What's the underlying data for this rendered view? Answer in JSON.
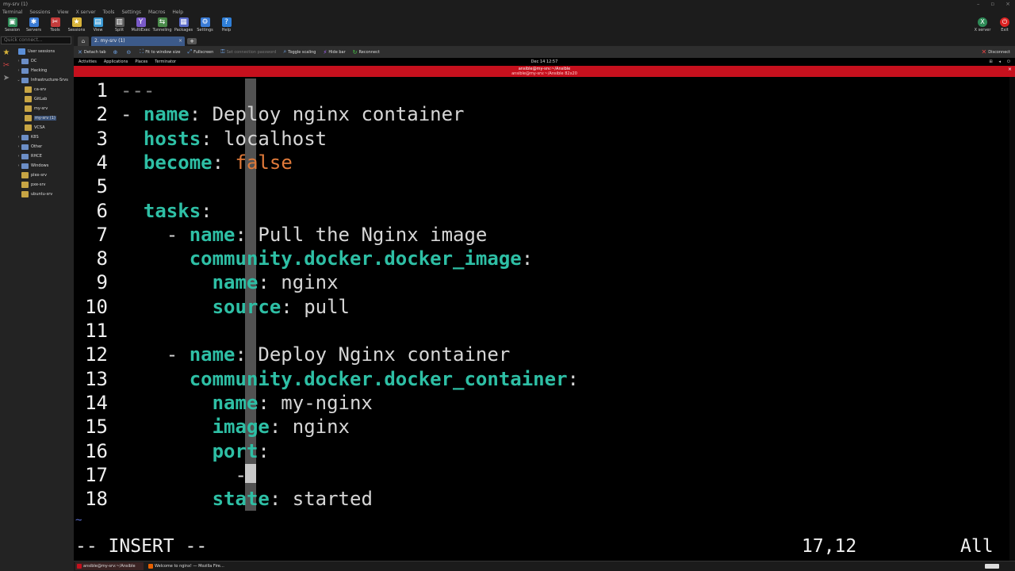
{
  "window": {
    "title": "my-srv (1)"
  },
  "menu": [
    "Terminal",
    "Sessions",
    "View",
    "X server",
    "Tools",
    "Settings",
    "Macros",
    "Help"
  ],
  "toolbar": [
    {
      "label": "Session",
      "icon": "session-icon",
      "color": "#2e8b57"
    },
    {
      "label": "Servers",
      "icon": "servers-icon",
      "color": "#3a7bd5"
    },
    {
      "label": "Tools",
      "icon": "tools-icon",
      "color": "#c43c3c"
    },
    {
      "label": "Sessions",
      "icon": "star-icon",
      "color": "#d9b43a"
    },
    {
      "label": "View",
      "icon": "view-icon",
      "color": "#3a9ad5"
    },
    {
      "label": "Split",
      "icon": "split-icon",
      "color": "#5a5a5a"
    },
    {
      "label": "MultiExec",
      "icon": "multiexec-icon",
      "color": "#7a5ac8"
    },
    {
      "label": "Tunneling",
      "icon": "tunneling-icon",
      "color": "#4a8a4a"
    },
    {
      "label": "Packages",
      "icon": "packages-icon",
      "color": "#5a6ac8"
    },
    {
      "label": "Settings",
      "icon": "settings-icon",
      "color": "#3a7bd5"
    },
    {
      "label": "Help",
      "icon": "help-icon",
      "color": "#2f7fd8"
    }
  ],
  "toolbar_right": [
    {
      "label": "X server",
      "icon": "x-server-icon",
      "color": "#2e8b57"
    },
    {
      "label": "Exit",
      "icon": "power-icon",
      "color": "#d22"
    }
  ],
  "quick_connect": {
    "placeholder": "Quick connect..."
  },
  "tree": [
    {
      "label": "User sessions",
      "type": "user",
      "level": 0,
      "arrow": ""
    },
    {
      "label": "DC",
      "type": "folder",
      "level": 1,
      "arrow": "›"
    },
    {
      "label": "Hacking",
      "type": "folder",
      "level": 1,
      "arrow": "›"
    },
    {
      "label": "Infrastructure-Srvs",
      "type": "folder",
      "level": 1,
      "arrow": "⌄"
    },
    {
      "label": "ca-srv",
      "type": "session",
      "level": 2,
      "arrow": ""
    },
    {
      "label": "GitLab",
      "type": "session",
      "level": 2,
      "arrow": ""
    },
    {
      "label": "my-srv",
      "type": "session",
      "level": 2,
      "arrow": ""
    },
    {
      "label": "my-srv (1)",
      "type": "session",
      "level": 2,
      "arrow": "",
      "selected": true
    },
    {
      "label": "VCSA",
      "type": "session",
      "level": 2,
      "arrow": ""
    },
    {
      "label": "K8S",
      "type": "folder",
      "level": 1,
      "arrow": "›"
    },
    {
      "label": "Other",
      "type": "folder",
      "level": 1,
      "arrow": "›"
    },
    {
      "label": "RHCE",
      "type": "folder",
      "level": 1,
      "arrow": "›"
    },
    {
      "label": "Windows",
      "type": "folder",
      "level": 1,
      "arrow": "›"
    },
    {
      "label": "plex-srv",
      "type": "session",
      "level": 1,
      "arrow": ""
    },
    {
      "label": "pxe-srv",
      "type": "session",
      "level": 1,
      "arrow": ""
    },
    {
      "label": "ubuntu-srv",
      "type": "session",
      "level": 1,
      "arrow": ""
    }
  ],
  "tabs": {
    "active_label": "2. my-srv (1)",
    "close": "×",
    "plus": "+"
  },
  "session_toolbar": [
    {
      "label": "Detach tab",
      "icon": "detach-icon",
      "dim": false
    },
    {
      "label": "",
      "icon": "zoom-in-icon",
      "dim": false
    },
    {
      "label": "",
      "icon": "zoom-out-icon",
      "dim": false
    },
    {
      "label": "Fit to window size",
      "icon": "fit-icon",
      "dim": false
    },
    {
      "label": "Fullscreen",
      "icon": "fullscreen-icon",
      "dim": false
    },
    {
      "label": "Set connection password",
      "icon": "key-icon",
      "dim": true
    },
    {
      "label": "Toggle scaling",
      "icon": "scaling-icon",
      "dim": false
    },
    {
      "label": "Hide bar",
      "icon": "pin-icon",
      "dim": false
    },
    {
      "label": "Reconnect",
      "icon": "reconnect-icon",
      "dim": false
    }
  ],
  "disconnect": {
    "label": "Disconnect"
  },
  "gnome": {
    "activities": "Activities",
    "applications": "Applications",
    "places": "Places",
    "terminator": "Terminator",
    "clock": "Dec 14 12:57"
  },
  "terminal": {
    "title": "ansible@my-srv:~/Ansible",
    "subtitle": "ansible@my-srv:~/Ansible 82x20"
  },
  "vim": {
    "lines": [
      {
        "n": "1",
        "segs": [
          {
            "t": "---",
            "c": "cmt"
          }
        ]
      },
      {
        "n": "2",
        "segs": [
          {
            "t": "- ",
            "c": "dash"
          },
          {
            "t": "name",
            "c": "key"
          },
          {
            "t": ": Deploy nginx container",
            "c": "str"
          }
        ]
      },
      {
        "n": "3",
        "segs": [
          {
            "t": "  ",
            "c": "str"
          },
          {
            "t": "hosts",
            "c": "key"
          },
          {
            "t": ": localhost",
            "c": "str"
          }
        ]
      },
      {
        "n": "4",
        "segs": [
          {
            "t": "  ",
            "c": "str"
          },
          {
            "t": "become",
            "c": "key"
          },
          {
            "t": ": ",
            "c": "str"
          },
          {
            "t": "false",
            "c": "bool"
          }
        ]
      },
      {
        "n": "5",
        "segs": []
      },
      {
        "n": "6",
        "segs": [
          {
            "t": "  ",
            "c": "str"
          },
          {
            "t": "tasks",
            "c": "key"
          },
          {
            "t": ":",
            "c": "str"
          }
        ]
      },
      {
        "n": "7",
        "segs": [
          {
            "t": "    - ",
            "c": "dash"
          },
          {
            "t": "name",
            "c": "key"
          },
          {
            "t": ": Pull the Nginx image",
            "c": "str"
          }
        ]
      },
      {
        "n": "8",
        "segs": [
          {
            "t": "      ",
            "c": "str"
          },
          {
            "t": "community.docker.docker_image",
            "c": "key"
          },
          {
            "t": ":",
            "c": "str"
          }
        ]
      },
      {
        "n": "9",
        "segs": [
          {
            "t": "        ",
            "c": "str"
          },
          {
            "t": "name",
            "c": "key"
          },
          {
            "t": ": nginx",
            "c": "str"
          }
        ]
      },
      {
        "n": "10",
        "segs": [
          {
            "t": "        ",
            "c": "str"
          },
          {
            "t": "source",
            "c": "key"
          },
          {
            "t": ": pull",
            "c": "str"
          }
        ]
      },
      {
        "n": "11",
        "segs": []
      },
      {
        "n": "12",
        "segs": [
          {
            "t": "    - ",
            "c": "dash"
          },
          {
            "t": "name",
            "c": "key"
          },
          {
            "t": ": Deploy Nginx container",
            "c": "str"
          }
        ]
      },
      {
        "n": "13",
        "segs": [
          {
            "t": "      ",
            "c": "str"
          },
          {
            "t": "community.docker.docker_container",
            "c": "key"
          },
          {
            "t": ":",
            "c": "str"
          }
        ]
      },
      {
        "n": "14",
        "segs": [
          {
            "t": "        ",
            "c": "str"
          },
          {
            "t": "name",
            "c": "key"
          },
          {
            "t": ": my-nginx",
            "c": "str"
          }
        ]
      },
      {
        "n": "15",
        "segs": [
          {
            "t": "        ",
            "c": "str"
          },
          {
            "t": "image",
            "c": "key"
          },
          {
            "t": ": nginx",
            "c": "str"
          }
        ]
      },
      {
        "n": "16",
        "segs": [
          {
            "t": "        ",
            "c": "str"
          },
          {
            "t": "port",
            "c": "key"
          },
          {
            "t": ":",
            "c": "str"
          }
        ]
      },
      {
        "n": "17",
        "segs": [
          {
            "t": "          -",
            "c": "dash"
          }
        ]
      },
      {
        "n": "18",
        "segs": [
          {
            "t": "        ",
            "c": "str"
          },
          {
            "t": "state",
            "c": "key"
          },
          {
            "t": ": started",
            "c": "str"
          }
        ]
      }
    ],
    "tilde": "~",
    "mode": "-- INSERT --",
    "position": "17,12",
    "scroll": "All"
  },
  "taskbar": [
    {
      "label": "ansible@my-srv:~/Ansible",
      "color": "#c6101d"
    },
    {
      "label": "Welcome to nginx! — Mozilla Fire…",
      "color": "#e66000"
    }
  ]
}
